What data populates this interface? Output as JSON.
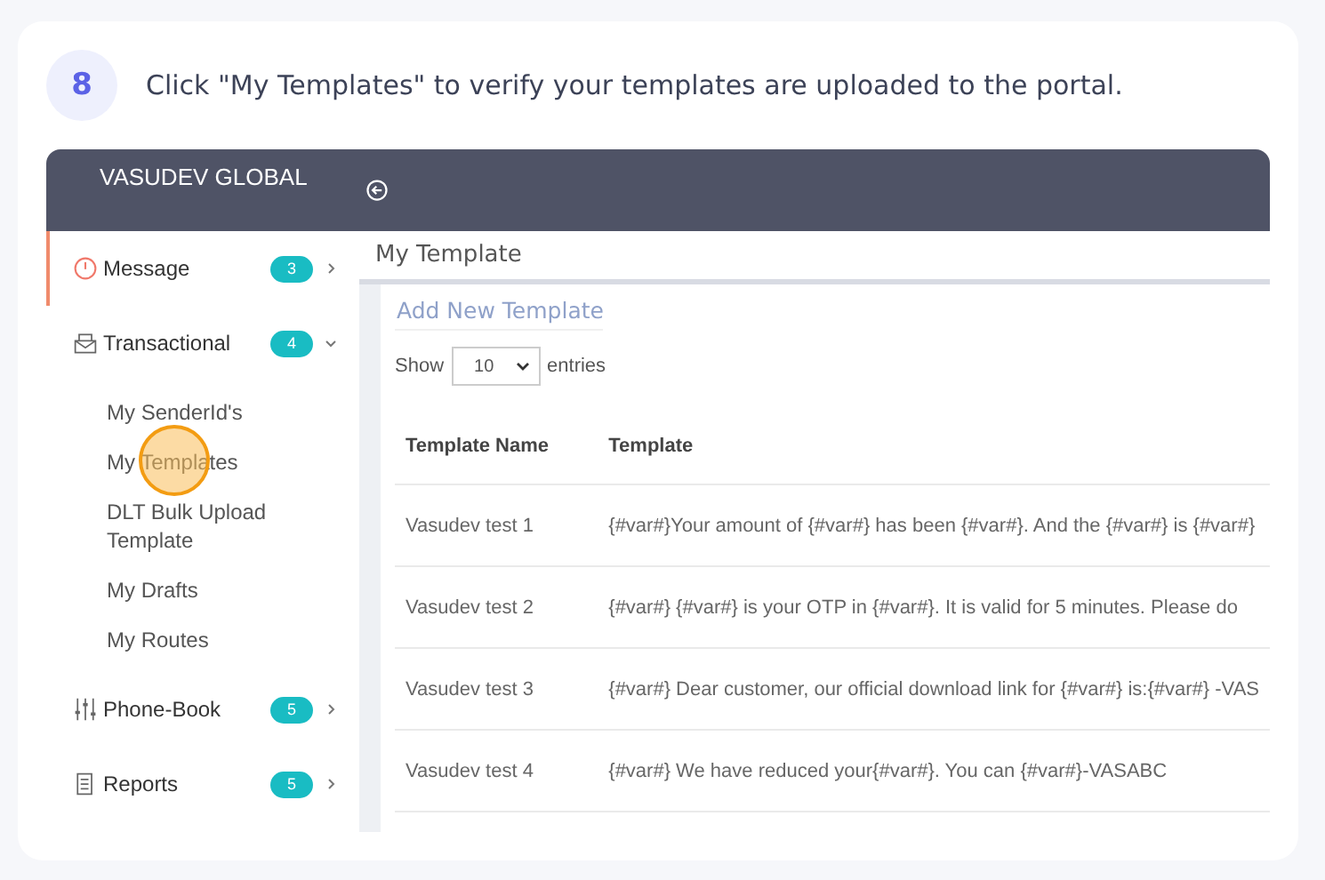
{
  "step": {
    "number": "8",
    "instruction": "Click \"My Templates\" to verify your templates are uploaded to the portal."
  },
  "app": {
    "brand": "VASUDEV GLOBAL",
    "sidebar": {
      "items": [
        {
          "label": "Message",
          "badge": "3",
          "selected": true,
          "expanded": false
        },
        {
          "label": "Transactional",
          "badge": "4",
          "selected": false,
          "expanded": true,
          "children": [
            {
              "label": "My SenderId's",
              "clicked": false
            },
            {
              "label": "My Templates",
              "clicked": true
            },
            {
              "label": "DLT Bulk Upload Template",
              "clicked": false
            },
            {
              "label": "My Drafts",
              "clicked": false
            },
            {
              "label": "My Routes",
              "clicked": false
            }
          ]
        },
        {
          "label": "Phone-Book",
          "badge": "5",
          "selected": false,
          "expanded": false
        },
        {
          "label": "Reports",
          "badge": "5",
          "selected": false,
          "expanded": false
        }
      ]
    },
    "page_title": "My Template",
    "add_link": "Add New Template",
    "show_label": "Show",
    "page_size": "10",
    "entries_label": "entries",
    "table": {
      "columns": [
        "Template Name",
        "Template"
      ],
      "rows": [
        [
          "Vasudev test 1",
          "{#var#}Your amount of {#var#} has been {#var#}. And the {#var#} is {#var#}"
        ],
        [
          "Vasudev test 2",
          "{#var#} {#var#} is your OTP in {#var#}. It is valid for 5 minutes. Please do"
        ],
        [
          "Vasudev test 3",
          "{#var#} Dear customer, our official download link for {#var#} is:{#var#} -VAS"
        ],
        [
          "Vasudev test 4",
          "{#var#} We have reduced your{#var#}. You can {#var#}-VASABC"
        ]
      ]
    }
  }
}
